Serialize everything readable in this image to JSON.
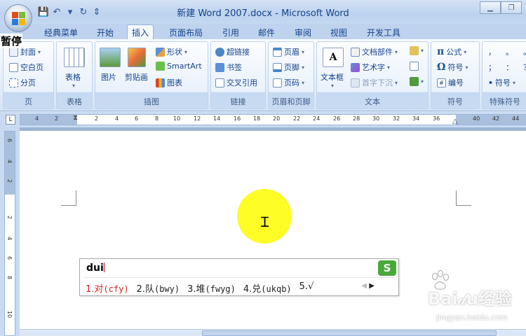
{
  "window": {
    "title": "新建 Word 2007.docx - Microsoft Word",
    "overlay_label": "暂停"
  },
  "quick_access": [
    {
      "icon": "save-icon",
      "glyph": "💾"
    },
    {
      "icon": "undo-icon",
      "glyph": "↶"
    },
    {
      "icon": "dropdown-icon",
      "glyph": "▾"
    },
    {
      "icon": "redo-icon",
      "glyph": "↻"
    },
    {
      "icon": "customize-icon",
      "glyph": "⇕"
    }
  ],
  "window_controls": [
    {
      "icon": "minimize-icon",
      "glyph": "▁"
    },
    {
      "icon": "restore-icon",
      "glyph": "❐"
    }
  ],
  "tabs": [
    {
      "label": "经典菜单",
      "active": false
    },
    {
      "label": "开始",
      "active": false
    },
    {
      "label": "插入",
      "active": true
    },
    {
      "label": "页面布局",
      "active": false
    },
    {
      "label": "引用",
      "active": false
    },
    {
      "label": "邮件",
      "active": false
    },
    {
      "label": "审阅",
      "active": false
    },
    {
      "label": "视图",
      "active": false
    },
    {
      "label": "开发工具",
      "active": false
    }
  ],
  "ribbon": {
    "pages": {
      "label": "页",
      "items": [
        "封面",
        "空白页",
        "分页"
      ]
    },
    "table": {
      "label": "表格",
      "button": "表格"
    },
    "illustrations": {
      "label": "插图",
      "picture": "图片",
      "clipart": "剪贴画",
      "shapes": "形状",
      "smartart": "SmartArt",
      "chart": "图表"
    },
    "links": {
      "label": "链接",
      "items": [
        "超链接",
        "书签",
        "交叉引用"
      ]
    },
    "header_footer": {
      "label": "页眉和页脚",
      "items": [
        "页眉",
        "页脚",
        "页码"
      ]
    },
    "text": {
      "label": "文本",
      "textbox": "文本框",
      "items": [
        "文档部件",
        "艺术字",
        "首字下沉"
      ]
    },
    "symbols": {
      "label": "符号",
      "items": [
        "公式",
        "符号",
        "编号"
      ]
    },
    "special": {
      "label": "特殊符号",
      "symbols": [
        "，",
        "。",
        "；",
        "：",
        "！",
        "？"
      ],
      "button": "符号"
    }
  },
  "ruler": {
    "corner": "L",
    "h_labels": [
      "4",
      "2",
      "2",
      "4",
      "6",
      "8",
      "10",
      "12",
      "14",
      "16",
      "18",
      "20",
      "22",
      "24",
      "26",
      "28",
      "30",
      "32",
      "34",
      "36",
      "40",
      "42",
      "44"
    ],
    "v_labels": [
      "6",
      "4",
      "2",
      "2",
      "4",
      "6",
      "8",
      "10"
    ]
  },
  "ime": {
    "composition": "dui",
    "candidates": [
      {
        "num": "1.",
        "char": "对",
        "code": "(cfy)"
      },
      {
        "num": "2.",
        "char": "队",
        "code": "(bwy)"
      },
      {
        "num": "3.",
        "char": "堆",
        "code": "(fwyg)"
      },
      {
        "num": "4.",
        "char": "兑",
        "code": "(ukqb)"
      },
      {
        "num": "5.",
        "char": "√",
        "code": ""
      }
    ],
    "logo": "S",
    "nav_prev": "◀",
    "nav_next": "▶"
  },
  "watermark": {
    "brand": "Bai𝒹u经验",
    "url": "jingyan.baidu.com"
  },
  "colors": {
    "ime_highlight": "#e02020",
    "cursor_spot": "#fffb00",
    "ime_logo": "#49a93a"
  }
}
